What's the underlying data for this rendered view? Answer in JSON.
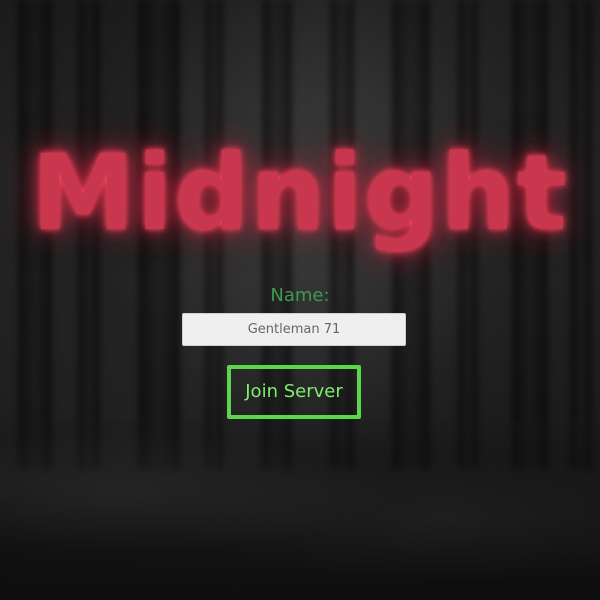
{
  "app": {
    "title": "Midnight"
  },
  "form": {
    "name_label": "Name:",
    "name_value": "Gentleman 71",
    "join_label": "Join Server"
  },
  "colors": {
    "title": "#c9374f",
    "title_glow": "#ff5064",
    "label": "#3f9b4c",
    "button": "#59d94a",
    "button_text": "#7cf06b",
    "input_bg": "#efefef"
  }
}
